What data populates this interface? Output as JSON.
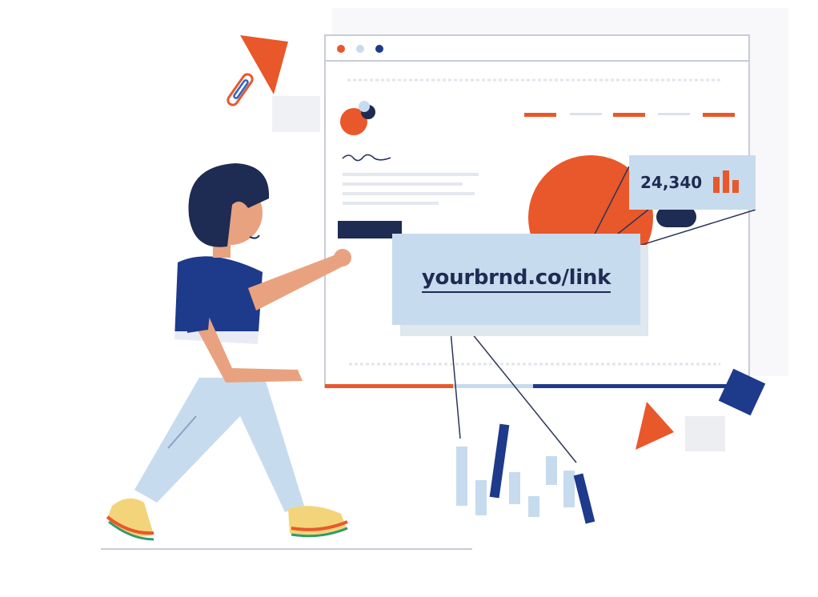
{
  "link_card": {
    "url": "yourbrnd.co/link"
  },
  "stat_card": {
    "value": "24,340",
    "icon": "bar-chart-icon"
  },
  "colors": {
    "orange": "#e8582a",
    "navy": "#1e3a8a",
    "dark_navy": "#1e2b52",
    "light_blue": "#c7dbee",
    "skin": "#e9a27f"
  }
}
